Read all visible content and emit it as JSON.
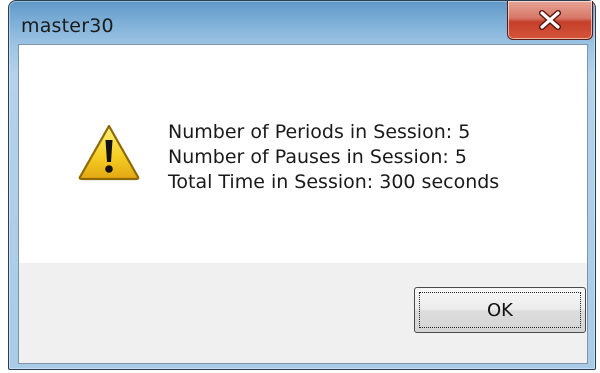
{
  "window": {
    "title": "master30",
    "close_icon": "close-icon"
  },
  "message": {
    "icon": "warning-icon",
    "lines": [
      "Number of Periods in Session: 5",
      "Number of Pauses in Session: 5",
      "Total Time in Session: 300 seconds"
    ]
  },
  "buttons": {
    "ok_label": "OK"
  },
  "colors": {
    "close_button": "#c53f2a",
    "warning_yellow": "#f6cf25"
  }
}
